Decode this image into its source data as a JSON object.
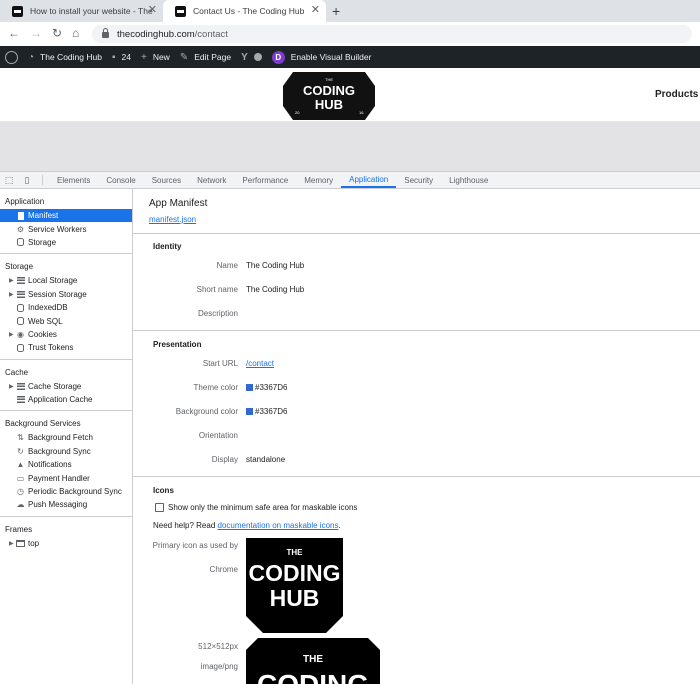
{
  "browser": {
    "tabs": [
      {
        "title": "How to install your website - The",
        "active": false
      },
      {
        "title": "Contact Us - The Coding Hub",
        "active": true
      }
    ],
    "new_tab": "+",
    "close_glyph": "✕",
    "url_host": "thecodinghub.com",
    "url_path": "/contact",
    "nav_icons": [
      "back-arrow-icon",
      "forward-arrow-icon",
      "reload-icon",
      "home-icon"
    ]
  },
  "admin_bar": {
    "site_name": "The Coding Hub",
    "comments_count": "24",
    "new_label": "New",
    "edit_label": "Edit Page",
    "visual_builder_label": "Enable Visual Builder",
    "divi_letter": "D",
    "bar_color": "#1d2327"
  },
  "site": {
    "logo_top": "THE",
    "logo_line1": "CODING",
    "logo_line2": "HUB",
    "logo_year_left": "20",
    "logo_year_right": "16",
    "nav_products": "Products"
  },
  "devtools": {
    "tabs": [
      "Elements",
      "Console",
      "Sources",
      "Network",
      "Performance",
      "Memory",
      "Application",
      "Security",
      "Lighthouse"
    ],
    "active_tab": "Application",
    "accent": "#1a73e8",
    "sidebar": {
      "sections": [
        {
          "title": "Application",
          "items": [
            {
              "label": "Manifest",
              "icon": "file-icon",
              "selected": true,
              "expandable": false
            },
            {
              "label": "Service Workers",
              "icon": "gear-icon",
              "selected": false,
              "expandable": false
            },
            {
              "label": "Storage",
              "icon": "database-icon",
              "selected": false,
              "expandable": false
            }
          ]
        },
        {
          "title": "Storage",
          "items": [
            {
              "label": "Local Storage",
              "icon": "grid-icon",
              "selected": false,
              "expandable": true
            },
            {
              "label": "Session Storage",
              "icon": "grid-icon",
              "selected": false,
              "expandable": true
            },
            {
              "label": "IndexedDB",
              "icon": "database-icon",
              "selected": false,
              "expandable": false
            },
            {
              "label": "Web SQL",
              "icon": "database-icon",
              "selected": false,
              "expandable": false
            },
            {
              "label": "Cookies",
              "icon": "cookie-icon",
              "selected": false,
              "expandable": true
            },
            {
              "label": "Trust Tokens",
              "icon": "database-icon",
              "selected": false,
              "expandable": false
            }
          ]
        },
        {
          "title": "Cache",
          "items": [
            {
              "label": "Cache Storage",
              "icon": "grid-icon",
              "selected": false,
              "expandable": true
            },
            {
              "label": "Application Cache",
              "icon": "grid-icon",
              "selected": false,
              "expandable": false
            }
          ]
        },
        {
          "title": "Background Services",
          "items": [
            {
              "label": "Background Fetch",
              "icon": "arrows-icon",
              "selected": false,
              "expandable": false
            },
            {
              "label": "Background Sync",
              "icon": "sync-icon",
              "selected": false,
              "expandable": false
            },
            {
              "label": "Notifications",
              "icon": "bell-icon",
              "selected": false,
              "expandable": false
            },
            {
              "label": "Payment Handler",
              "icon": "card-icon",
              "selected": false,
              "expandable": false
            },
            {
              "label": "Periodic Background Sync",
              "icon": "clock-icon",
              "selected": false,
              "expandable": false
            },
            {
              "label": "Push Messaging",
              "icon": "cloud-icon",
              "selected": false,
              "expandable": false
            }
          ]
        },
        {
          "title": "Frames",
          "items": [
            {
              "label": "top",
              "icon": "frame-icon",
              "selected": false,
              "expandable": true
            }
          ]
        }
      ]
    },
    "manifest": {
      "title": "App Manifest",
      "link": "manifest.json",
      "identity": {
        "title": "Identity",
        "name_label": "Name",
        "name_value": "The Coding Hub",
        "short_label": "Short name",
        "short_value": "The Coding Hub",
        "desc_label": "Description",
        "desc_value": ""
      },
      "presentation": {
        "title": "Presentation",
        "start_label": "Start URL",
        "start_value": "/contact",
        "theme_label": "Theme color",
        "theme_value": "#3367D6",
        "bg_label": "Background color",
        "bg_value": "#3367D6",
        "orient_label": "Orientation",
        "orient_value": "",
        "display_label": "Display",
        "display_value": "standalone",
        "swatch_color": "#3367D6"
      },
      "icons": {
        "title": "Icons",
        "checkbox_label": "Show only the minimum safe area for maskable icons",
        "help_prefix": "Need help? Read ",
        "help_link": "documentation on maskable icons",
        "help_suffix": ".",
        "primary_line1": "Primary icon as used by",
        "primary_line2": "Chrome",
        "size": "512×512px",
        "mime": "image/png",
        "logo_top": "THE",
        "logo_line1": "CODING",
        "logo_line2": "HUB"
      }
    }
  }
}
